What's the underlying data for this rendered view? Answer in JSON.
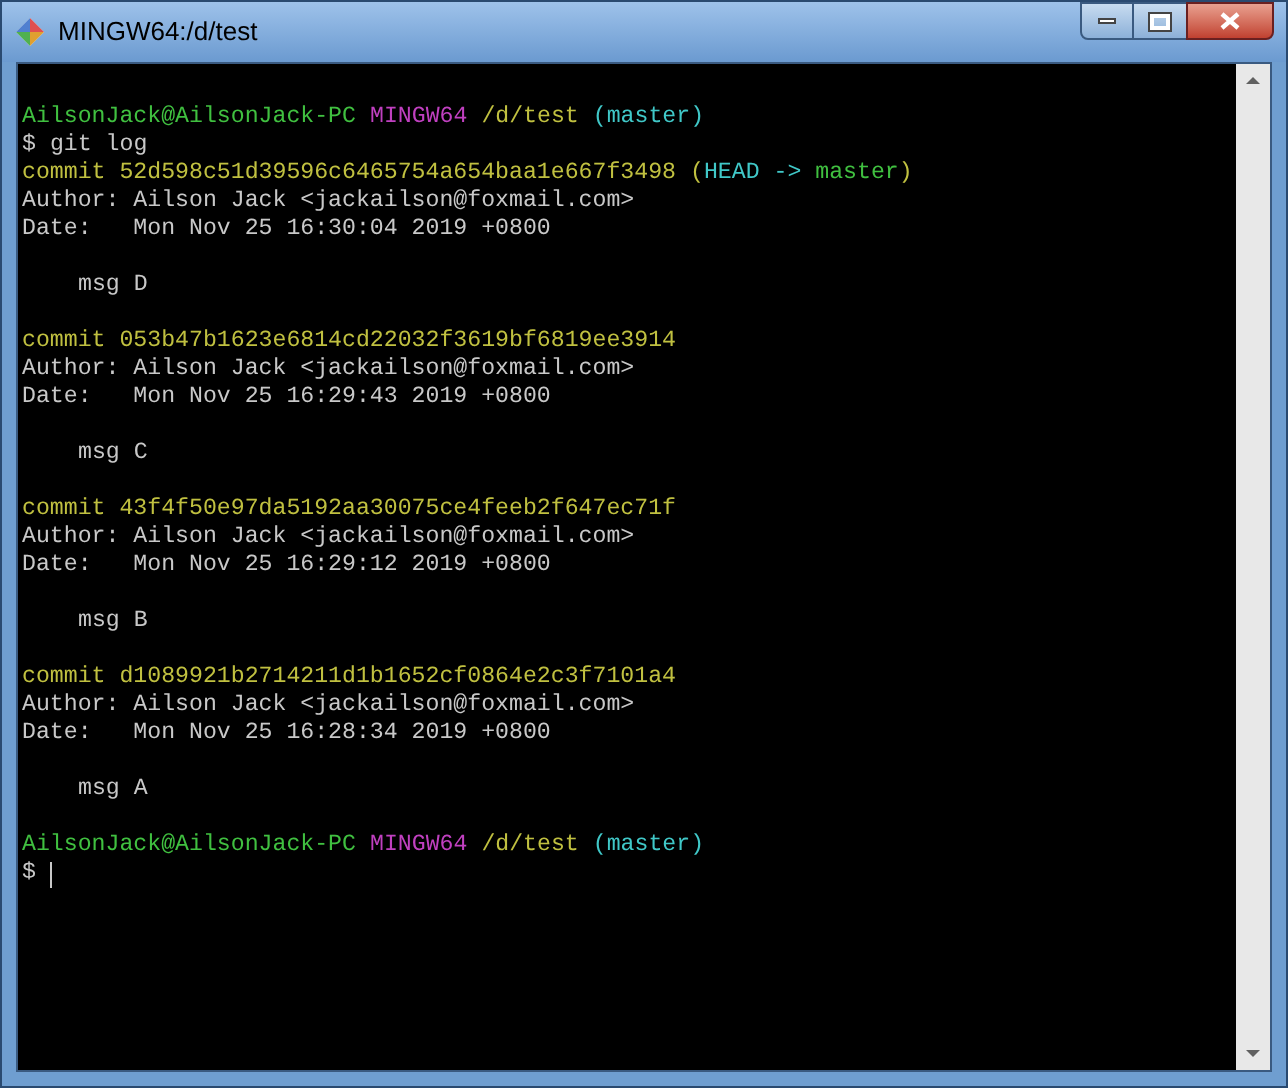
{
  "window": {
    "title": "MINGW64:/d/test"
  },
  "terminal": {
    "entries": [
      {
        "kind": "prompt",
        "user": "AilsonJack@AilsonJack-PC",
        "system": "MINGW64",
        "path": "/d/test",
        "branch": "(master)",
        "sign": "$",
        "command": "git log",
        "cursor": false
      },
      {
        "kind": "commit",
        "hash": "commit 52d598c51d39596c6465754a654baa1e667f3498",
        "decoration": [
          {
            "text": "(",
            "color": "#c0c040"
          },
          {
            "text": "HEAD -> ",
            "color": "#40c8c8"
          },
          {
            "text": "master",
            "color": "#40c040"
          },
          {
            "text": ")",
            "color": "#c0c040"
          }
        ],
        "author": "Author: Ailson Jack <jackailson@foxmail.com>",
        "date": "Date:   Mon Nov 25 16:30:04 2019 +0800",
        "message": "msg D"
      },
      {
        "kind": "commit",
        "hash": "commit 053b47b1623e6814cd22032f3619bf6819ee3914",
        "author": "Author: Ailson Jack <jackailson@foxmail.com>",
        "date": "Date:   Mon Nov 25 16:29:43 2019 +0800",
        "message": "msg C"
      },
      {
        "kind": "commit",
        "hash": "commit 43f4f50e97da5192aa30075ce4feeb2f647ec71f",
        "author": "Author: Ailson Jack <jackailson@foxmail.com>",
        "date": "Date:   Mon Nov 25 16:29:12 2019 +0800",
        "message": "msg B"
      },
      {
        "kind": "commit",
        "hash": "commit d1089921b2714211d1b1652cf0864e2c3f7101a4",
        "author": "Author: Ailson Jack <jackailson@foxmail.com>",
        "date": "Date:   Mon Nov 25 16:28:34 2019 +0800",
        "message": "msg A"
      },
      {
        "kind": "prompt",
        "user": "AilsonJack@AilsonJack-PC",
        "system": "MINGW64",
        "path": "/d/test",
        "branch": "(master)",
        "sign": "$",
        "cursor": true
      }
    ]
  }
}
